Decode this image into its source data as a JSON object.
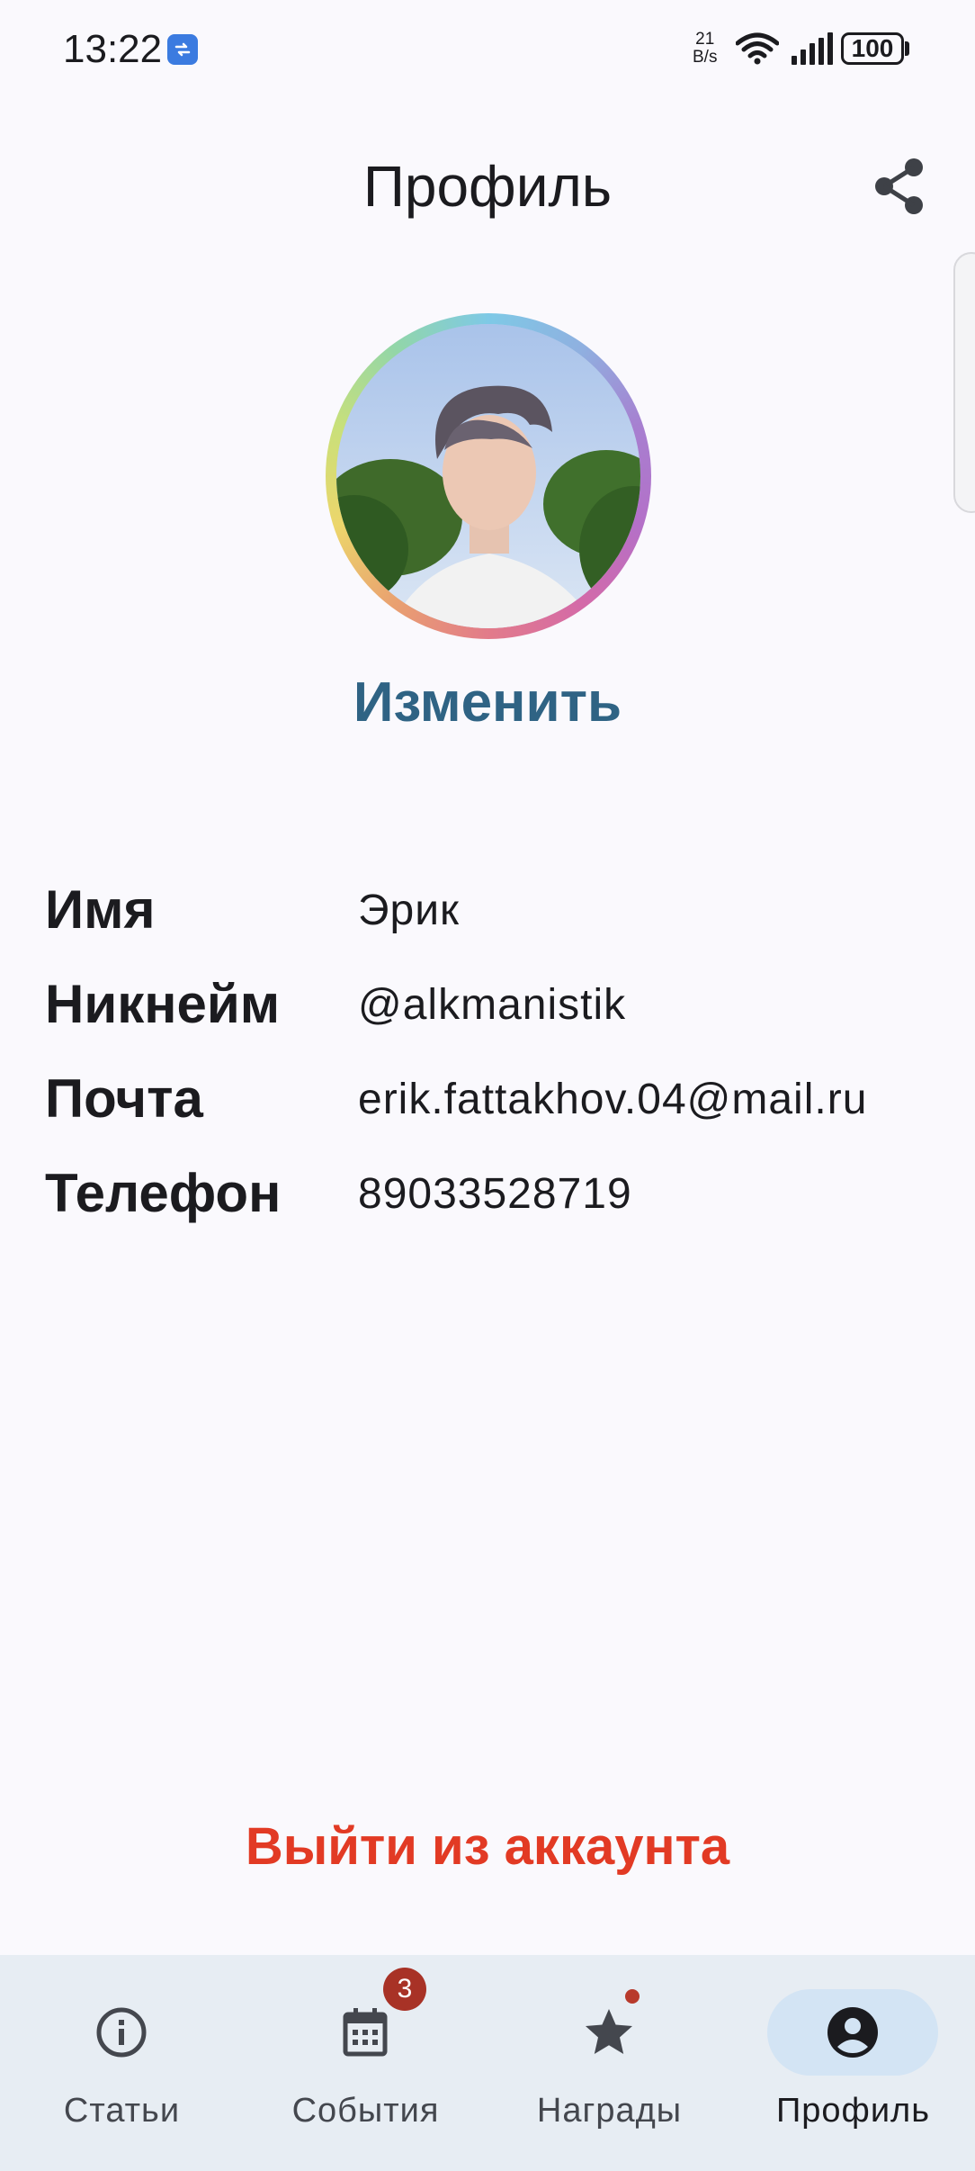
{
  "status_bar": {
    "time": "13:22",
    "net_speed_value": "21",
    "net_speed_unit": "B/s",
    "battery": "100"
  },
  "header": {
    "title": "Профиль"
  },
  "profile": {
    "change_label": "Изменить",
    "fields": [
      {
        "label": "Имя",
        "value": "Эрик"
      },
      {
        "label": "Никнейм",
        "value": "@alkmanistik"
      },
      {
        "label": "Почта",
        "value": "erik.fattakhov.04@mail.ru"
      },
      {
        "label": "Телефон",
        "value": "89033528719"
      }
    ],
    "logout_label": "Выйти из аккаунта"
  },
  "bottom_nav": {
    "items": [
      {
        "label": "Статьи",
        "icon": "info-icon",
        "active": false
      },
      {
        "label": "События",
        "icon": "calendar-icon",
        "active": false,
        "badge": "3"
      },
      {
        "label": "Награды",
        "icon": "star-icon",
        "active": false,
        "dot": true
      },
      {
        "label": "Профиль",
        "icon": "account-circle-icon",
        "active": true
      }
    ]
  },
  "colors": {
    "accent": "#2f6384",
    "danger": "#e23a24",
    "nav_bg": "#e7edf3",
    "nav_active_pill": "#d3e4f4",
    "badge": "#a83226"
  }
}
